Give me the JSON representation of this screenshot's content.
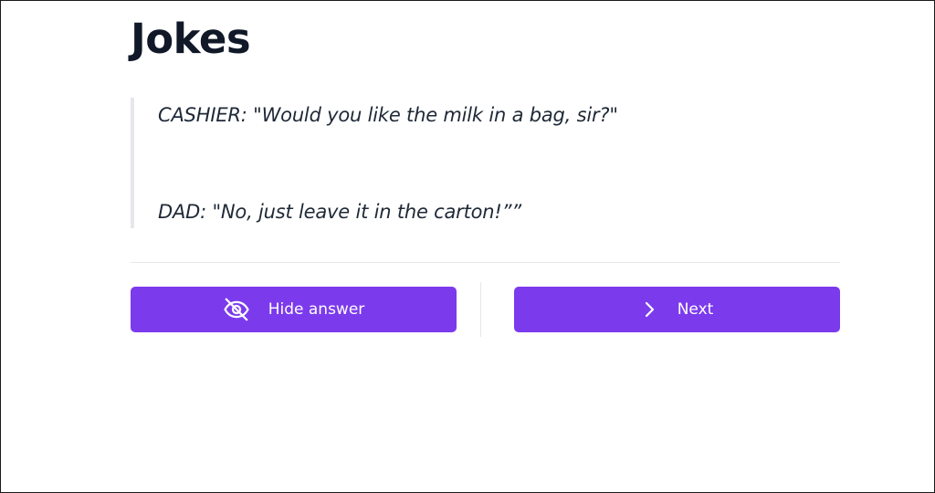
{
  "page": {
    "title": "Jokes"
  },
  "joke": {
    "question": "CASHIER: \"Would you like the milk in a bag, sir?\"",
    "answer": "DAD: \"No, just leave it in the carton!””"
  },
  "actions": {
    "hide_answer": {
      "label": "Hide answer",
      "icon": "eye-off-icon"
    },
    "next": {
      "label": "Next",
      "icon": "chevron-right-icon"
    }
  },
  "colors": {
    "accent": "#7c3aed",
    "text": "#111827",
    "divider": "#e5e7eb"
  }
}
